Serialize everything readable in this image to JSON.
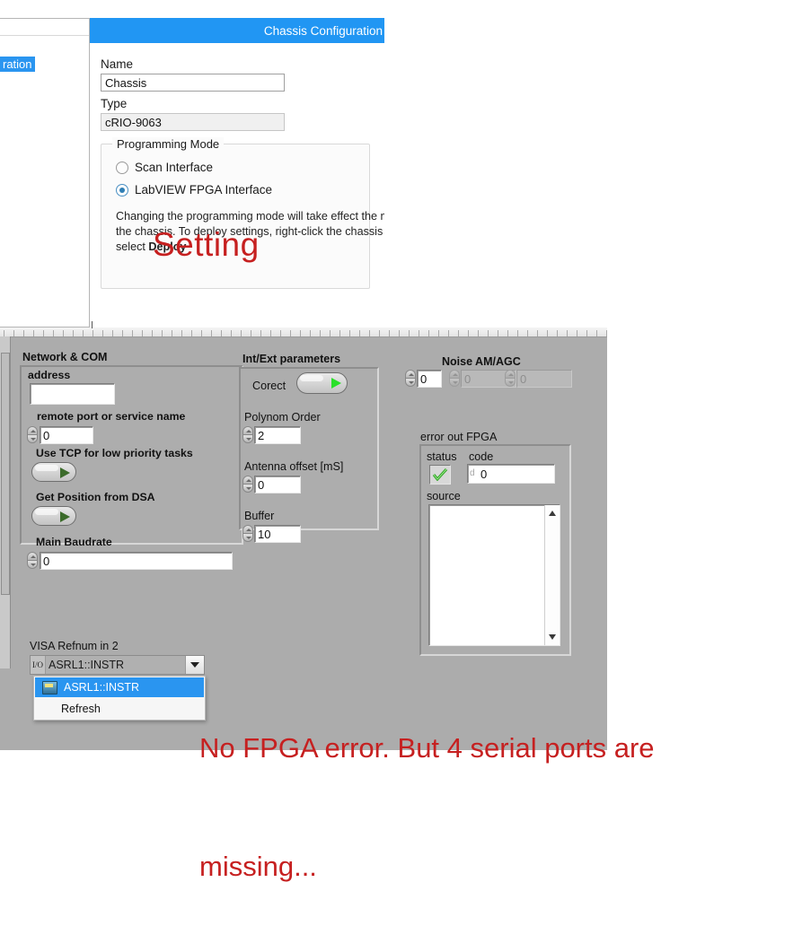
{
  "chassis_window": {
    "tree": {
      "selected_item_fragment": "ration"
    },
    "title": "Chassis Configuration",
    "fields": [
      {
        "label": "Name",
        "value": "Chassis",
        "readonly": false
      },
      {
        "label": "Type",
        "value": "cRIO-9063",
        "readonly": true
      }
    ],
    "programming_mode": {
      "legend": "Programming Mode",
      "options": [
        {
          "label": "Scan Interface",
          "selected": false
        },
        {
          "label": "LabVIEW FPGA Interface",
          "selected": true
        }
      ],
      "help_line1": "Changing the programming mode will take effect the ne",
      "help_line2": "the chassis. To deploy settings, right-click the chassis in ",
      "help_line3_pre": "select ",
      "help_line3_bold": "Deploy"
    }
  },
  "annotations": {
    "setting": "Setting",
    "fpga_line1": "No FPGA error. But 4 serial ports are",
    "fpga_line2": "missing..."
  },
  "lv_panel": {
    "sections": {
      "network_com": "Network & COM",
      "int_ext": "Int/Ext parameters",
      "noise": "Noise AM/AGC",
      "error_out": "error out FPGA"
    },
    "network": {
      "address": {
        "label": "address",
        "value": ""
      },
      "remote_port": {
        "label": "remote port or service name",
        "value": "0"
      },
      "use_tcp": {
        "label": "Use TCP for low priority tasks",
        "state": "off"
      },
      "get_position": {
        "label": "Get Position from DSA",
        "state": "off"
      },
      "main_baudrate": {
        "label": "Main Baudrate",
        "value": "0"
      }
    },
    "int_ext": {
      "corect": {
        "label": "Corect",
        "state": "on"
      },
      "polynom_order": {
        "label": "Polynom Order",
        "value": "2"
      },
      "antenna_offset": {
        "label": "Antenna  offset [mS]",
        "value": "0"
      },
      "buffer": {
        "label": "Buffer",
        "value": "10"
      }
    },
    "noise": {
      "values": [
        {
          "value": "0",
          "enabled": true
        },
        {
          "value": "0",
          "enabled": false
        },
        {
          "value": "0",
          "enabled": false
        }
      ]
    },
    "error_out": {
      "status_label": "status",
      "status_icon": "check-mark",
      "code_label": "code",
      "code_value": "0",
      "code_radix": "d",
      "source_label": "source",
      "source_value": ""
    },
    "visa": {
      "label": "VISA Refnum in 2",
      "io_glyph": "I/O",
      "selected": "ASRL1::INSTR",
      "menu_items": [
        {
          "label": "ASRL1::INSTR",
          "selected": true,
          "has_icon": true
        },
        {
          "label": "Refresh",
          "selected": false,
          "has_icon": false
        }
      ]
    }
  },
  "colors": {
    "title_blue": "#2196f3",
    "selection_blue": "#2a95f0",
    "annotation_red": "#c62020",
    "panel_gray": "#acacac",
    "led_green": "#2ae02a"
  }
}
